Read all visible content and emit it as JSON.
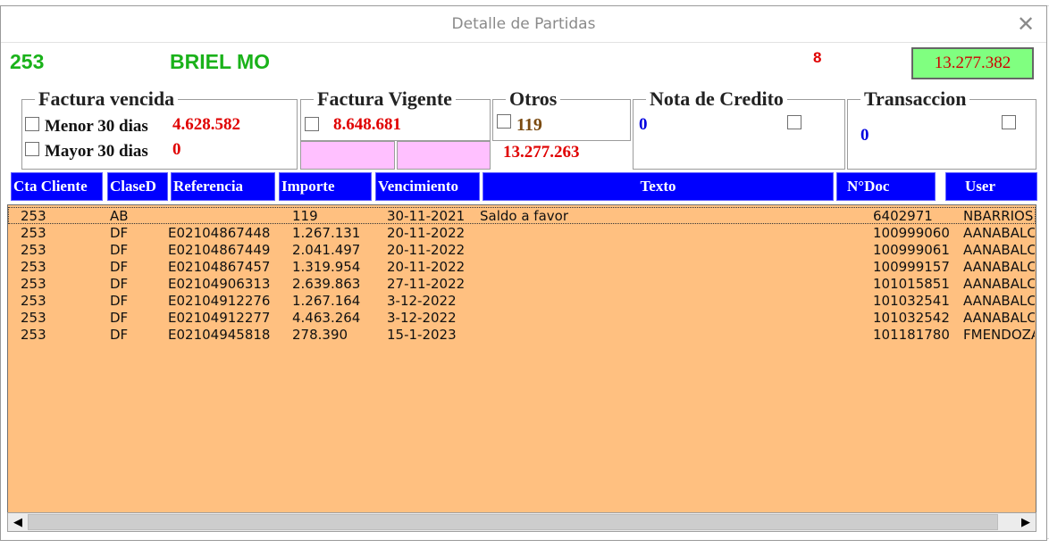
{
  "window": {
    "title": "Detalle de Partidas",
    "close_glyph": "✕"
  },
  "cliente": {
    "numero": "253",
    "nombre": "BRIEL MO",
    "count": "8",
    "total": "13.277.382"
  },
  "factura_vencida": {
    "label": "Factura vencida",
    "menor_label": "Menor 30 dias",
    "menor_value": "4.628.582",
    "mayor_label": "Mayor 30 dias",
    "mayor_value": "0"
  },
  "factura_vigente": {
    "label": "Factura Vigente",
    "value": "8.648.681",
    "subtotal": "13.277.263"
  },
  "otros": {
    "label": "Otros",
    "value": "119"
  },
  "nota_credito": {
    "label": "Nota de Credito",
    "value": "0"
  },
  "transaccion": {
    "label": "Transaccion",
    "value": "0"
  },
  "columns": [
    "Cta Cliente",
    "ClaseD",
    "Referencia",
    "Importe",
    "Vencimiento",
    "Texto",
    "N°Doc",
    "User"
  ],
  "rows": [
    [
      "253",
      "AB",
      "",
      "119",
      "30-11-2021",
      "Saldo a favor",
      "6402971",
      "NBARRIOS"
    ],
    [
      "253",
      "DF",
      "E02104867448",
      "1.267.131",
      "20-11-2022",
      "",
      "100999060",
      "AANABALC"
    ],
    [
      "253",
      "DF",
      "E02104867449",
      "2.041.497",
      "20-11-2022",
      "",
      "100999061",
      "AANABALC"
    ],
    [
      "253",
      "DF",
      "E02104867457",
      "1.319.954",
      "20-11-2022",
      "",
      "100999157",
      "AANABALC"
    ],
    [
      "253",
      "DF",
      "E02104906313",
      "2.639.863",
      "27-11-2022",
      "",
      "101015851",
      "AANABALC"
    ],
    [
      "253",
      "DF",
      "E02104912276",
      "1.267.164",
      "3-12-2022",
      "",
      "101032541",
      "AANABALC"
    ],
    [
      "253",
      "DF",
      "E02104912277",
      "4.463.264",
      "3-12-2022",
      "",
      "101032542",
      "AANABALC"
    ],
    [
      "253",
      "DF",
      "E02104945818",
      "278.390",
      "15-1-2023",
      "",
      "101181780",
      "FMENDOZA"
    ]
  ],
  "scroll": {
    "left_glyph": "◀",
    "right_glyph": "▶"
  },
  "colors": {
    "header_bg": "#0000ff",
    "list_bg": "#ffc080",
    "total_bg": "#80ff80",
    "accent_green": "#1ab21a",
    "accent_red": "#e00000"
  }
}
